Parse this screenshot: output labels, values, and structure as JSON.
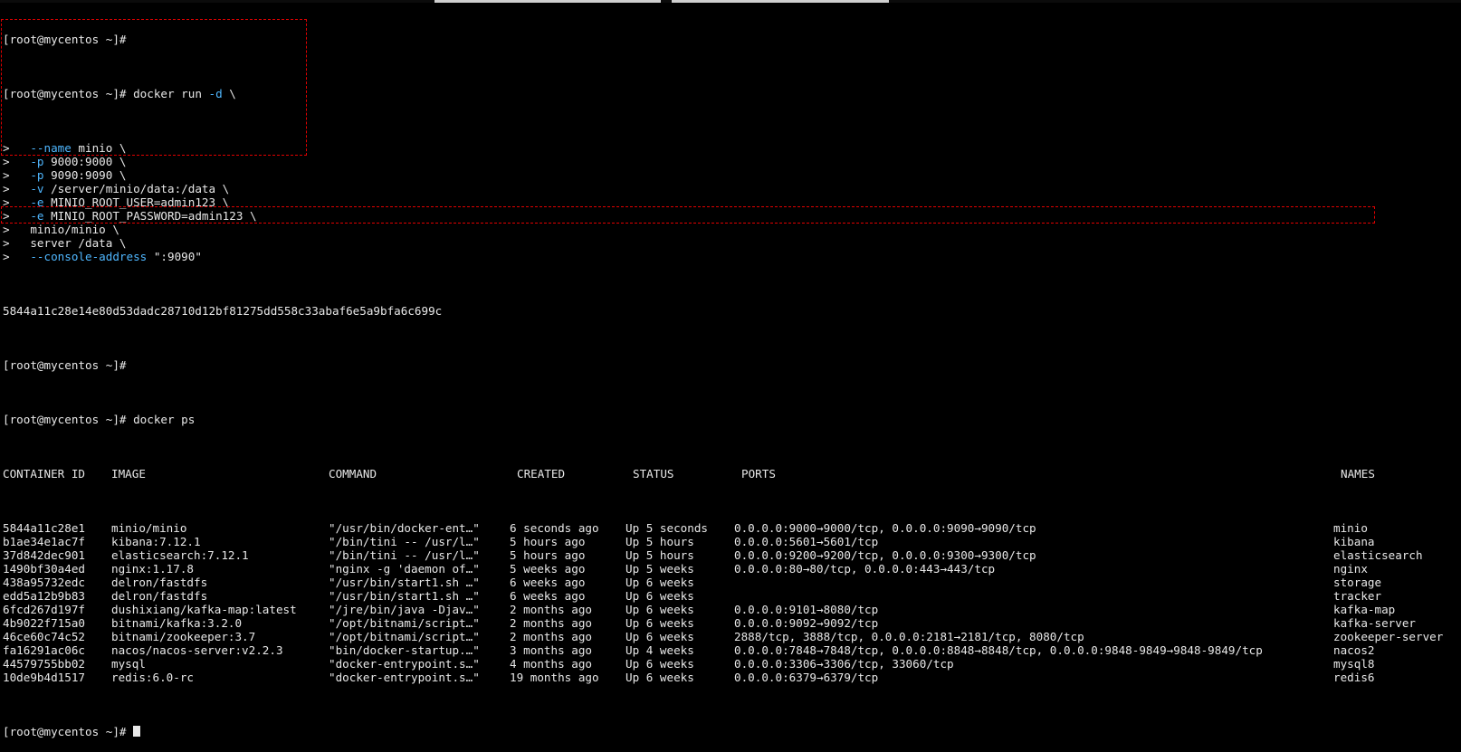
{
  "prompt": "[root@mycentos ~]#",
  "continuation": ">",
  "lines": {
    "first": "[root@mycentos ~]#",
    "run_cmd": "docker run",
    "run_flag": "-d",
    "run_tail": " \\"
  },
  "run_args": [
    {
      "flag": "--name",
      "value": " minio \\"
    },
    {
      "flag": "-p",
      "value": " 9000:9000 \\"
    },
    {
      "flag": "-p",
      "value": " 9090:9090 \\"
    },
    {
      "flag": "-v",
      "value": " /server/minio/data:/data \\"
    },
    {
      "flag": "-e",
      "value": " MINIO_ROOT_USER=admin123 \\"
    },
    {
      "flag": "-e",
      "value": " MINIO_ROOT_PASSWORD=admin123 \\"
    },
    {
      "flag": "",
      "value": "minio/minio \\"
    },
    {
      "flag": "",
      "value": "server /data \\"
    },
    {
      "flag": "--console-address",
      "value": " \":9090\""
    }
  ],
  "container_hash": "5844a11c28e14e80d53dadc28710d12bf81275dd558c33abaf6e5a9bfa6c699c",
  "ps_cmd": "docker ps",
  "ps_headers": {
    "id": "CONTAINER ID",
    "image": "IMAGE",
    "command": "COMMAND",
    "created": "CREATED",
    "status": "STATUS",
    "ports": "PORTS",
    "names": "NAMES"
  },
  "ps_rows": [
    {
      "id": "5844a11c28e1",
      "image": "minio/minio",
      "command": "\"/usr/bin/docker-ent…\"",
      "created": "6 seconds ago",
      "status": "Up 5 seconds",
      "ports": "0.0.0.0:9000→9000/tcp, 0.0.0.0:9090→9090/tcp",
      "names": "minio"
    },
    {
      "id": "b1ae34e1ac7f",
      "image": "kibana:7.12.1",
      "command": "\"/bin/tini -- /usr/l…\"",
      "created": "5 hours ago",
      "status": "Up 5 hours",
      "ports": "0.0.0.0:5601→5601/tcp",
      "names": "kibana"
    },
    {
      "id": "37d842dec901",
      "image": "elasticsearch:7.12.1",
      "command": "\"/bin/tini -- /usr/l…\"",
      "created": "5 hours ago",
      "status": "Up 5 hours",
      "ports": "0.0.0.0:9200→9200/tcp, 0.0.0.0:9300→9300/tcp",
      "names": "elasticsearch"
    },
    {
      "id": "1490bf30a4ed",
      "image": "nginx:1.17.8",
      "command": "\"nginx -g 'daemon of…\"",
      "created": "5 weeks ago",
      "status": "Up 5 weeks",
      "ports": "0.0.0.0:80→80/tcp, 0.0.0.0:443→443/tcp",
      "names": "nginx"
    },
    {
      "id": "438a95732edc",
      "image": "delron/fastdfs",
      "command": "\"/usr/bin/start1.sh …\"",
      "created": "6 weeks ago",
      "status": "Up 6 weeks",
      "ports": "",
      "names": "storage"
    },
    {
      "id": "edd5a12b9b83",
      "image": "delron/fastdfs",
      "command": "\"/usr/bin/start1.sh …\"",
      "created": "6 weeks ago",
      "status": "Up 6 weeks",
      "ports": "",
      "names": "tracker"
    },
    {
      "id": "6fcd267d197f",
      "image": "dushixiang/kafka-map:latest",
      "command": "\"/jre/bin/java -Djav…\"",
      "created": "2 months ago",
      "status": "Up 6 weeks",
      "ports": "0.0.0.0:9101→8080/tcp",
      "names": "kafka-map"
    },
    {
      "id": "4b9022f715a0",
      "image": "bitnami/kafka:3.2.0",
      "command": "\"/opt/bitnami/script…\"",
      "created": "2 months ago",
      "status": "Up 6 weeks",
      "ports": "0.0.0.0:9092→9092/tcp",
      "names": "kafka-server"
    },
    {
      "id": "46ce60c74c52",
      "image": "bitnami/zookeeper:3.7",
      "command": "\"/opt/bitnami/script…\"",
      "created": "2 months ago",
      "status": "Up 6 weeks",
      "ports": "2888/tcp, 3888/tcp, 0.0.0.0:2181→2181/tcp, 8080/tcp",
      "names": "zookeeper-server"
    },
    {
      "id": "fa16291ac06c",
      "image": "nacos/nacos-server:v2.2.3",
      "command": "\"bin/docker-startup.…\"",
      "created": "3 months ago",
      "status": "Up 4 weeks",
      "ports": "0.0.0.0:7848→7848/tcp, 0.0.0.0:8848→8848/tcp, 0.0.0.0:9848-9849→9848-9849/tcp",
      "names": "nacos2"
    },
    {
      "id": "44579755bb02",
      "image": "mysql",
      "command": "\"docker-entrypoint.s…\"",
      "created": "4 months ago",
      "status": "Up 6 weeks",
      "ports": "0.0.0.0:3306→3306/tcp, 33060/tcp",
      "names": "mysql8"
    },
    {
      "id": "10de9b4d1517",
      "image": "redis:6.0-rc",
      "command": "\"docker-entrypoint.s…\"",
      "created": "19 months ago",
      "status": "Up 6 weeks",
      "ports": "0.0.0.0:6379→6379/tcp",
      "names": "redis6"
    }
  ],
  "colors": {
    "background": "#000000",
    "text": "#e8e8e8",
    "flag": "#4fb7ff",
    "highlight_box": "#e00000"
  }
}
